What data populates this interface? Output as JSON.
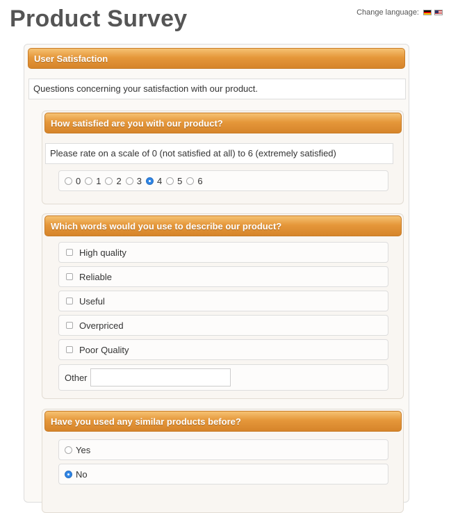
{
  "page": {
    "title": "Product Survey"
  },
  "language": {
    "label": "Change language:",
    "flags": [
      "german-flag-icon",
      "english-flag-icon"
    ]
  },
  "section": {
    "title": "User Satisfaction",
    "description": "Questions concerning your satisfaction with our product."
  },
  "q1": {
    "title": "How satisfied are you with our product?",
    "description": "Please rate on a scale of 0 (not satisfied at all) to 6 (extremely satisfied)",
    "options": [
      "0",
      "1",
      "2",
      "3",
      "4",
      "5",
      "6"
    ],
    "selected": "4"
  },
  "q2": {
    "title": "Which words would you use to describe our product?",
    "options": [
      "High quality",
      "Reliable",
      "Useful",
      "Overpriced",
      "Poor Quality"
    ],
    "other_label": "Other",
    "other_value": ""
  },
  "q3": {
    "title": "Have you used any similar products before?",
    "options": [
      "Yes",
      "No"
    ],
    "selected": "No"
  },
  "colors": {
    "accent": "#e5973a",
    "radio_selected": "#2f86e6"
  }
}
